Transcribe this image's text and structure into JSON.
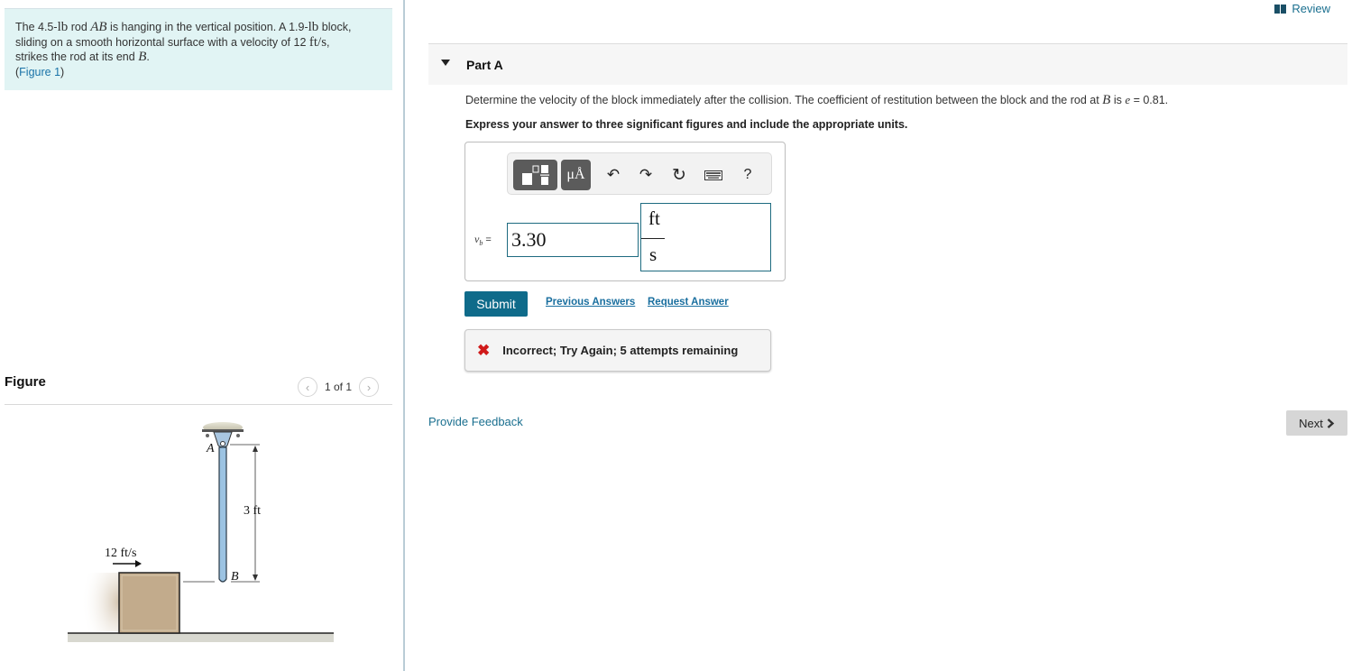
{
  "problem": {
    "text_1": "The 4.5-",
    "unit_lb": "lb",
    "text_2": " rod ",
    "rod_name": "AB",
    "text_3": " is hanging in the vertical position. A 1.9-",
    "text_4": " block,",
    "text_5": "sliding on a smooth horizontal surface with a velocity of 12 ",
    "velocity_unit": "ft/s",
    "text_6": ",",
    "text_7": "strikes the rod at its end ",
    "end_name": "B",
    "text_8": ".",
    "figure_link": "Figure 1"
  },
  "figure": {
    "title": "Figure",
    "pager": "1 of 1",
    "prev_icon": "chevron-left-icon",
    "next_icon": "chevron-right-icon",
    "labels": {
      "point_a": "A",
      "point_b": "B",
      "length": "3 ft",
      "velocity": "12 ft/s"
    }
  },
  "header": {
    "review_label": "Review",
    "review_icon": "book-icon"
  },
  "part": {
    "title": "Part A",
    "question_pre": "Determine the velocity of the block immediately after the collision. The coefficient of restitution between the block and the rod at ",
    "question_var": "B",
    "question_mid": " is ",
    "question_e": "e",
    "question_post": " = 0.81.",
    "instruction": "Express your answer to three significant figures and include the appropriate units."
  },
  "answer": {
    "toolbar": {
      "templates_icon": "templates-icon",
      "units_label": "μÅ",
      "undo_icon": "undo-icon",
      "redo_icon": "redo-icon",
      "reset_icon": "reset-icon",
      "keyboard_icon": "keyboard-icon",
      "help_label": "?"
    },
    "variable": "v",
    "variable_sub": "b",
    "equals": "=",
    "value": "3.30",
    "unit_numerator": "ft",
    "unit_denominator": "s"
  },
  "actions": {
    "submit": "Submit",
    "previous_answers": "Previous Answers",
    "request_answer": "Request Answer"
  },
  "feedback": {
    "icon": "x-icon",
    "message": "Incorrect; Try Again; 5 attempts remaining"
  },
  "footer": {
    "provide_feedback": "Provide Feedback",
    "next_label": "Next"
  },
  "colors": {
    "accent": "#0f6b8a",
    "link": "#1a6f8f",
    "problem_bg": "#e1f4f4",
    "error": "#d01a1a"
  }
}
